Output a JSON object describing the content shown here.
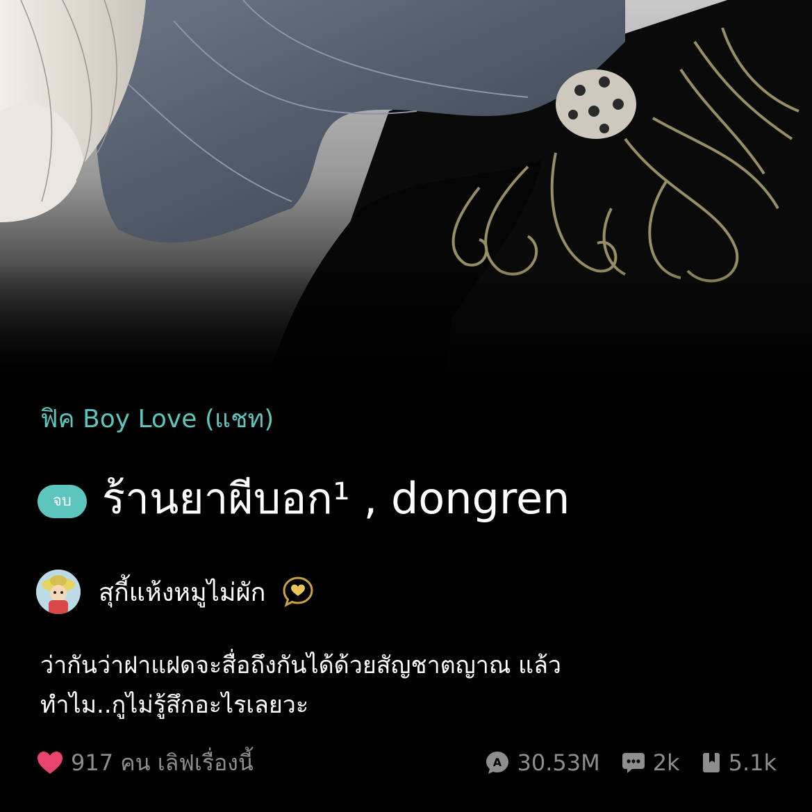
{
  "story": {
    "category": "ฟิค Boy Love (แชท)",
    "status_badge": "จบ",
    "title": "ร้านยาผีบอก¹ , dongren"
  },
  "author": {
    "name": "สุกี้แห้งหมูไม่ผัก",
    "verified_icon": "gold-heart-chat-bubble-icon"
  },
  "description": {
    "line1": "ว่ากันว่าฝาแฝดจะสื่อถึงกันได้ด้วยสัญชาตญาณ แล้ว",
    "line2": "ทำไม..กูไม่รู้สึกอะไรเลยวะ"
  },
  "stats": {
    "love_text": "917 คน เลิฟเรื่องนี้",
    "views": "30.53M",
    "comments": "2k",
    "bookmarks": "5.1k"
  },
  "colors": {
    "accent": "#5cc5be",
    "heart": "#e8456d",
    "muted": "#8e8e8e",
    "background": "#000000"
  }
}
